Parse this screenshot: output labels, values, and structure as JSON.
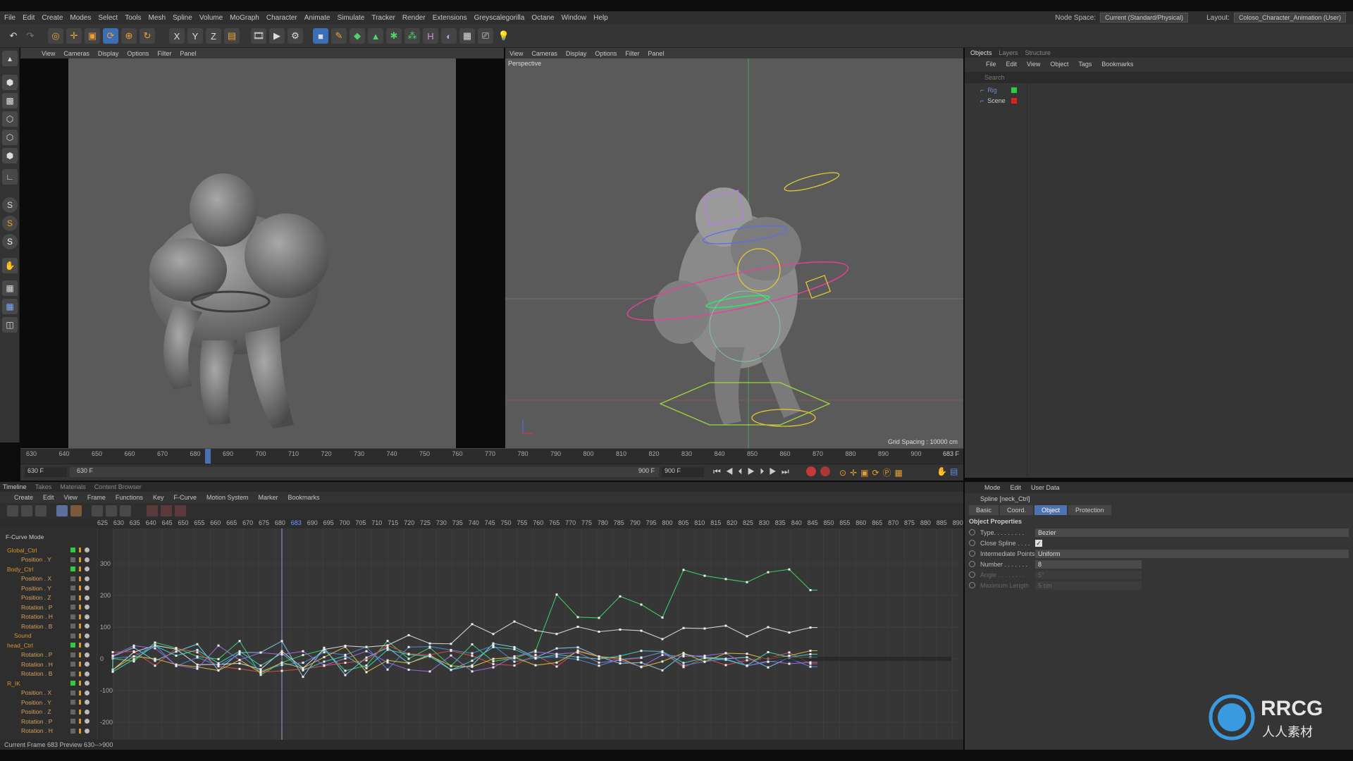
{
  "menubar": {
    "items": [
      "File",
      "Edit",
      "Create",
      "Modes",
      "Select",
      "Tools",
      "Mesh",
      "Spline",
      "Volume",
      "MoGraph",
      "Character",
      "Animate",
      "Simulate",
      "Tracker",
      "Render",
      "Extensions",
      "Greyscalegorilla",
      "Octane",
      "Window",
      "Help"
    ],
    "node_space_label": "Node Space:",
    "node_space_value": "Current (Standard/Physical)",
    "layout_label": "Layout:",
    "layout_value": "Coloso_Character_Animation (User)"
  },
  "viewport_left": {
    "menu": [
      "View",
      "Cameras",
      "Display",
      "Options",
      "Filter",
      "Panel"
    ]
  },
  "viewport_right": {
    "menu": [
      "View",
      "Cameras",
      "Display",
      "Options",
      "Filter",
      "Panel"
    ],
    "camera_label": "Perspective",
    "grid_spacing": "Grid Spacing : 10000 cm"
  },
  "ruler": {
    "ticks": [
      "630",
      "640",
      "650",
      "660",
      "670",
      "680",
      "690",
      "700",
      "710",
      "720",
      "730",
      "740",
      "750",
      "760",
      "770",
      "780",
      "790",
      "800",
      "810",
      "820",
      "830",
      "840",
      "850",
      "860",
      "870",
      "880",
      "890",
      "900"
    ],
    "current": "683",
    "current_field": "683 F"
  },
  "playbar": {
    "start": "630 F",
    "range_start": "630 F",
    "range_end": "900 F",
    "end": "900 F"
  },
  "timeline": {
    "tabs": [
      "Timeline",
      "Takes",
      "Materials",
      "Content Browser"
    ],
    "menu": [
      "Create",
      "Edit",
      "View",
      "Frame",
      "Functions",
      "Key",
      "F-Curve",
      "Motion System",
      "Marker",
      "Bookmarks"
    ],
    "mode_label": "F-Curve Mode",
    "ticks": [
      "625",
      "630",
      "635",
      "640",
      "645",
      "650",
      "655",
      "660",
      "665",
      "670",
      "675",
      "680",
      "683",
      "690",
      "695",
      "700",
      "705",
      "710",
      "715",
      "720",
      "725",
      "730",
      "735",
      "740",
      "745",
      "750",
      "755",
      "760",
      "765",
      "770",
      "775",
      "780",
      "785",
      "790",
      "795",
      "800",
      "805",
      "810",
      "815",
      "820",
      "825",
      "830",
      "835",
      "840",
      "845",
      "850",
      "855",
      "860",
      "865",
      "870",
      "875",
      "880",
      "885",
      "890"
    ],
    "y_labels": [
      "300",
      "200",
      "100",
      "0",
      "-100",
      "-200"
    ],
    "tracks": [
      {
        "name": "Global_Ctrl",
        "indent": 1,
        "group": true
      },
      {
        "name": "Position . Y",
        "indent": 3,
        "group": false
      },
      {
        "name": "Body_Ctrl",
        "indent": 1,
        "group": true
      },
      {
        "name": "Position . X",
        "indent": 3,
        "group": false
      },
      {
        "name": "Position . Y",
        "indent": 3,
        "group": false
      },
      {
        "name": "Position . Z",
        "indent": 3,
        "group": false
      },
      {
        "name": "Rotation . P",
        "indent": 3,
        "group": false
      },
      {
        "name": "Rotation . H",
        "indent": 3,
        "group": false
      },
      {
        "name": "Rotation . B",
        "indent": 3,
        "group": false
      },
      {
        "name": "Sound",
        "indent": 2,
        "group": false
      },
      {
        "name": "head_Ctrl",
        "indent": 1,
        "group": true
      },
      {
        "name": "Rotation . P",
        "indent": 3,
        "group": false
      },
      {
        "name": "Rotation . H",
        "indent": 3,
        "group": false
      },
      {
        "name": "Rotation . B",
        "indent": 3,
        "group": false
      },
      {
        "name": "R_IK",
        "indent": 1,
        "group": true
      },
      {
        "name": "Position . X",
        "indent": 3,
        "group": false
      },
      {
        "name": "Position . Y",
        "indent": 3,
        "group": false
      },
      {
        "name": "Position . Z",
        "indent": 3,
        "group": false
      },
      {
        "name": "Rotation . P",
        "indent": 3,
        "group": false
      },
      {
        "name": "Rotation . H",
        "indent": 3,
        "group": false
      }
    ]
  },
  "status": {
    "text": "Current Frame  683  Preview  630-->900"
  },
  "objects": {
    "tabs": [
      "Objects",
      "Layers",
      "Structure"
    ],
    "menu": [
      "File",
      "Edit",
      "View",
      "Object",
      "Tags",
      "Bookmarks"
    ],
    "search_placeholder": "Search",
    "items": [
      {
        "name": "Rig",
        "color": "#2ecc40"
      },
      {
        "name": "Scene",
        "color": "#e02020"
      }
    ]
  },
  "attributes": {
    "menu": [
      "Mode",
      "Edit",
      "User Data"
    ],
    "title": "Spline [neck_Ctrl]",
    "tabs": [
      "Basic",
      "Coord.",
      "Object",
      "Protection"
    ],
    "active_tab": "Object",
    "section": "Object Properties",
    "props": [
      {
        "label": "Type. . . . . . . . .",
        "value": "Bezier",
        "dim": false
      },
      {
        "label": "Close Spline . . . .",
        "value": "",
        "dim": false,
        "check": true
      },
      {
        "label": "Intermediate Points",
        "value": "Uniform",
        "dim": false
      },
      {
        "label": "Number . . . . . . .",
        "value": "8",
        "dim": false
      },
      {
        "label": "Angle . . . . . . . .",
        "value": "5°",
        "dim": true
      },
      {
        "label": "Maximum Length",
        "value": "5 cm",
        "dim": true
      }
    ]
  },
  "watermark": {
    "brand": "RRCG",
    "sub": "人人素材"
  }
}
